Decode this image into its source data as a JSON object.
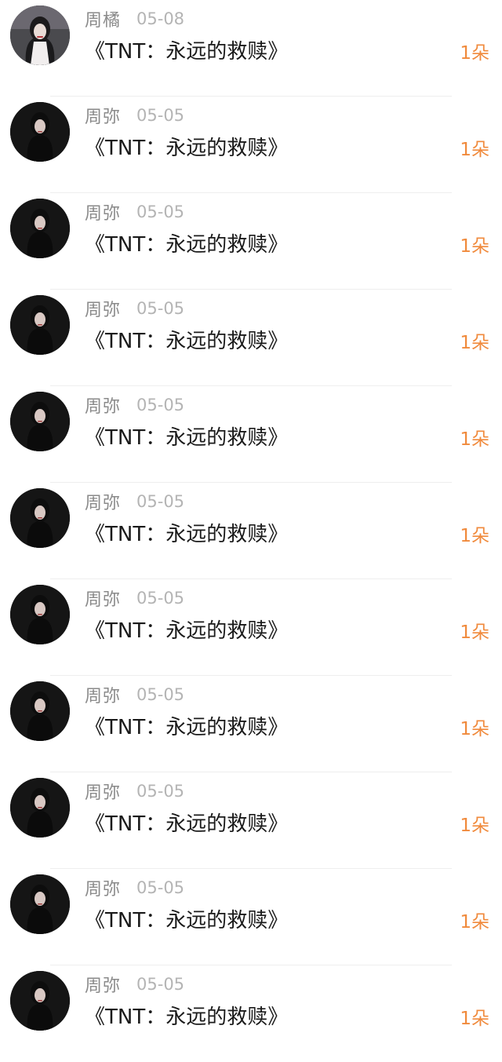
{
  "gifts": [
    {
      "name": "周橘",
      "date": "05-08",
      "title": "《TNT：永远的救赎》",
      "count": "1朵",
      "avatar_icon": "avatar-photo-icon"
    },
    {
      "name": "周弥",
      "date": "05-05",
      "title": "《TNT：永远的救赎》",
      "count": "1朵",
      "avatar_icon": "avatar-photo-icon"
    },
    {
      "name": "周弥",
      "date": "05-05",
      "title": "《TNT：永远的救赎》",
      "count": "1朵",
      "avatar_icon": "avatar-photo-icon"
    },
    {
      "name": "周弥",
      "date": "05-05",
      "title": "《TNT：永远的救赎》",
      "count": "1朵",
      "avatar_icon": "avatar-photo-icon"
    },
    {
      "name": "周弥",
      "date": "05-05",
      "title": "《TNT：永远的救赎》",
      "count": "1朵",
      "avatar_icon": "avatar-photo-icon"
    },
    {
      "name": "周弥",
      "date": "05-05",
      "title": "《TNT：永远的救赎》",
      "count": "1朵",
      "avatar_icon": "avatar-photo-icon"
    },
    {
      "name": "周弥",
      "date": "05-05",
      "title": "《TNT：永远的救赎》",
      "count": "1朵",
      "avatar_icon": "avatar-photo-icon"
    },
    {
      "name": "周弥",
      "date": "05-05",
      "title": "《TNT：永远的救赎》",
      "count": "1朵",
      "avatar_icon": "avatar-photo-icon"
    },
    {
      "name": "周弥",
      "date": "05-05",
      "title": "《TNT：永远的救赎》",
      "count": "1朵",
      "avatar_icon": "avatar-photo-icon"
    },
    {
      "name": "周弥",
      "date": "05-05",
      "title": "《TNT：永远的救赎》",
      "count": "1朵",
      "avatar_icon": "avatar-photo-icon"
    },
    {
      "name": "周弥",
      "date": "05-05",
      "title": "《TNT：永远的救赎》",
      "count": "1朵",
      "avatar_icon": "avatar-photo-icon"
    }
  ],
  "colors": {
    "name": "#8a8a8a",
    "date": "#b4b4b4",
    "title": "#1a1a1a",
    "count": "#f08a3c",
    "divider": "#eeeeee"
  }
}
